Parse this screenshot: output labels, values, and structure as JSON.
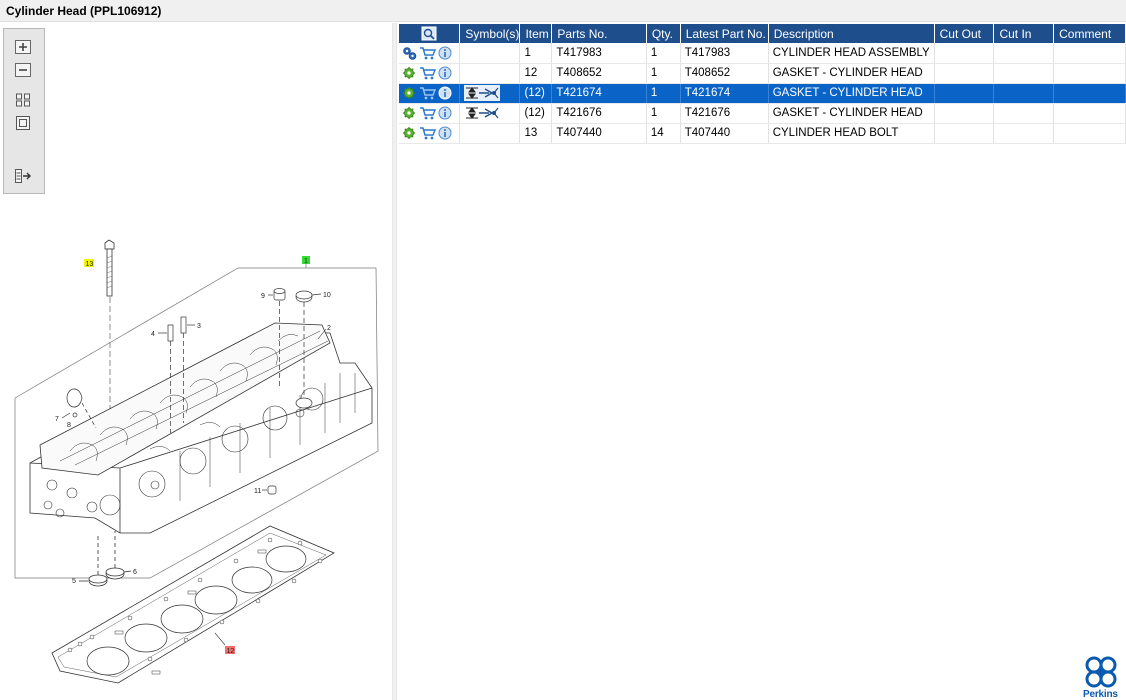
{
  "window": {
    "title": "Cylinder Head (PPL106912)"
  },
  "toolbar": {
    "tools": [
      "zoom-in",
      "zoom-out",
      "fit-all",
      "fit-window",
      "export"
    ]
  },
  "diagram": {
    "callouts": [
      "13",
      "1",
      "9",
      "10",
      "2",
      "4",
      "3",
      "7",
      "8",
      "11",
      "5",
      "6",
      "12"
    ]
  },
  "table": {
    "columns": [
      "",
      "Symbol(s)",
      "Item",
      "Parts No.",
      "Qty.",
      "Latest Part No.",
      "Description",
      "Cut Out",
      "Cut In",
      "Comment"
    ],
    "rows": [
      {
        "icon_type": "assembly-gears",
        "symbol": "",
        "item": "1",
        "part_no": "T417983",
        "qty": "1",
        "latest": "T417983",
        "description": "CYLINDER HEAD ASSEMBLY",
        "cut_out": "",
        "cut_in": "",
        "comment": ""
      },
      {
        "icon_type": "gear",
        "symbol": "",
        "item": "12",
        "part_no": "T408652",
        "qty": "1",
        "latest": "T408652",
        "description": "GASKET - CYLINDER HEAD",
        "cut_out": "",
        "cut_in": "",
        "comment": ""
      },
      {
        "icon_type": "gear",
        "symbol": "alternative",
        "item": "(12)",
        "part_no": "T421674",
        "qty": "1",
        "latest": "T421674",
        "description": "GASKET - CYLINDER HEAD",
        "cut_out": "",
        "cut_in": "",
        "comment": "",
        "selected": true
      },
      {
        "icon_type": "gear",
        "symbol": "alternative",
        "item": "(12)",
        "part_no": "T421676",
        "qty": "1",
        "latest": "T421676",
        "description": "GASKET - CYLINDER HEAD",
        "cut_out": "",
        "cut_in": "",
        "comment": ""
      },
      {
        "icon_type": "gear",
        "symbol": "",
        "item": "13",
        "part_no": "T407440",
        "qty": "14",
        "latest": "T407440",
        "description": "CYLINDER HEAD BOLT",
        "cut_out": "",
        "cut_in": "",
        "comment": ""
      }
    ]
  },
  "brand": {
    "name": "Perkins",
    "color": "#0a5bb0"
  },
  "colors": {
    "header_bg": "#1f4e8c",
    "selected_row": "#0a64c8",
    "highlight_yellow": "#f5f500",
    "highlight_green": "#33dd33",
    "highlight_red": "#f07070"
  }
}
